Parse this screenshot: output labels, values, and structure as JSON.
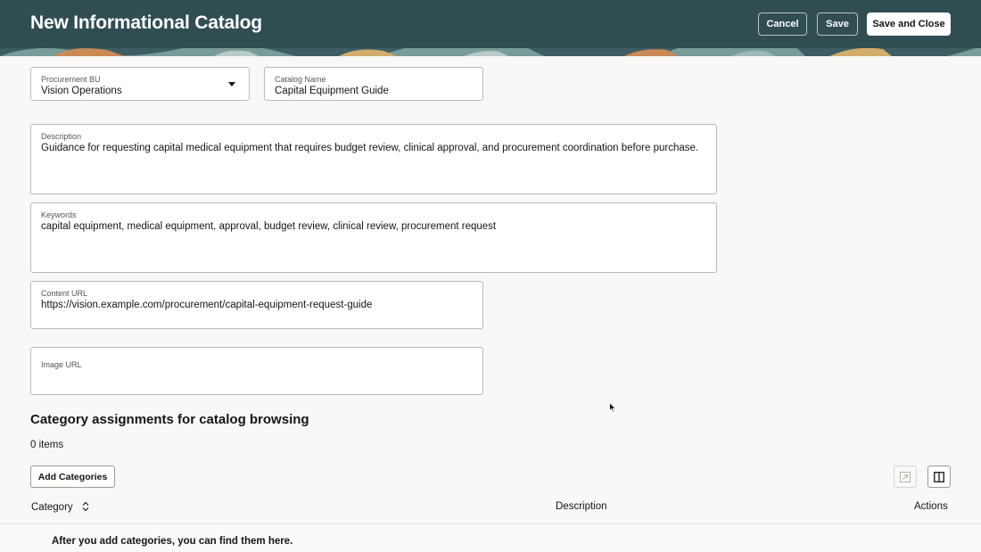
{
  "header": {
    "title": "New Informational Catalog",
    "cancel_label": "Cancel",
    "save_label": "Save",
    "save_close_label": "Save and Close",
    "bg_color": "#304d52"
  },
  "form": {
    "procurement_bu": {
      "label": "Procurement BU",
      "value": "Vision Operations"
    },
    "catalog_name": {
      "label": "Catalog Name",
      "value": "Capital Equipment Guide"
    },
    "description": {
      "label": "Description",
      "value": "Guidance for requesting capital medical equipment that requires budget review, clinical approval, and procurement coordination before purchase."
    },
    "keywords": {
      "label": "Keywords",
      "value": "capital equipment, medical equipment, approval, budget review, clinical review, procurement request"
    },
    "content_url": {
      "label": "Content URL",
      "value": "https://vision.example.com/procurement/capital-equipment-request-guide"
    },
    "image_url": {
      "label": "Image URL",
      "value": ""
    }
  },
  "categories": {
    "title": "Category assignments for catalog browsing",
    "count_text": "0 items",
    "add_label": "Add Categories",
    "columns": {
      "category": "Category",
      "description": "Description",
      "actions": "Actions"
    },
    "empty_message": "After you add categories, you can find them here."
  },
  "icons": {
    "dropdown": "caret-down-icon",
    "sort": "sort-icon",
    "detach": "detach-icon",
    "columns": "columns-icon",
    "cursor": "mouse-pointer-icon"
  }
}
